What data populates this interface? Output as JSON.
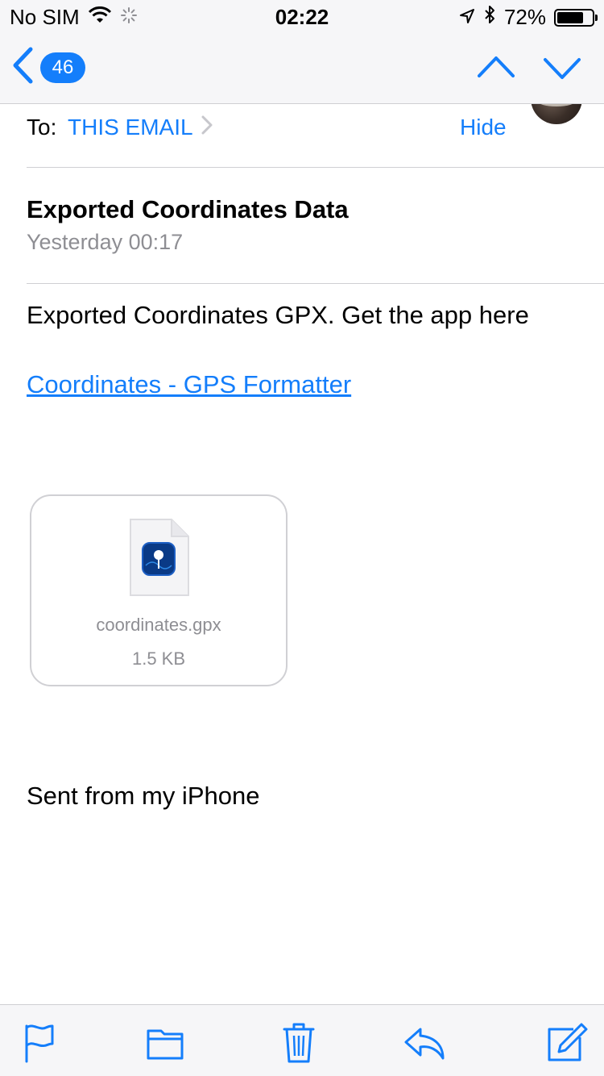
{
  "status_bar": {
    "carrier": "No SIM",
    "time": "02:22",
    "battery_percent": "72%"
  },
  "nav": {
    "unread_count": "46"
  },
  "header": {
    "to_label": "To:",
    "recipient": "THIS EMAIL",
    "hide_label": "Hide"
  },
  "message": {
    "subject": "Exported Coordinates Data",
    "date": "Yesterday 00:17",
    "body_text": "Exported Coordinates GPX. Get the app here",
    "link_text": "Coordinates - GPS Formatter",
    "signature": "Sent from my iPhone"
  },
  "attachment": {
    "filename": "coordinates.gpx",
    "size": "1.5 KB"
  },
  "colors": {
    "accent": "#147efb",
    "secondary_text": "#8e8e93",
    "separator": "#cfcfd3"
  },
  "icons": {
    "status": [
      "wifi-icon",
      "activity-spinner-icon",
      "location-arrow-icon",
      "bluetooth-icon",
      "battery-icon"
    ],
    "nav": [
      "back-chevron-icon",
      "previous-message-icon",
      "next-message-icon"
    ],
    "toolbar": [
      "flag-icon",
      "folder-icon",
      "trash-icon",
      "reply-icon",
      "compose-icon"
    ]
  }
}
